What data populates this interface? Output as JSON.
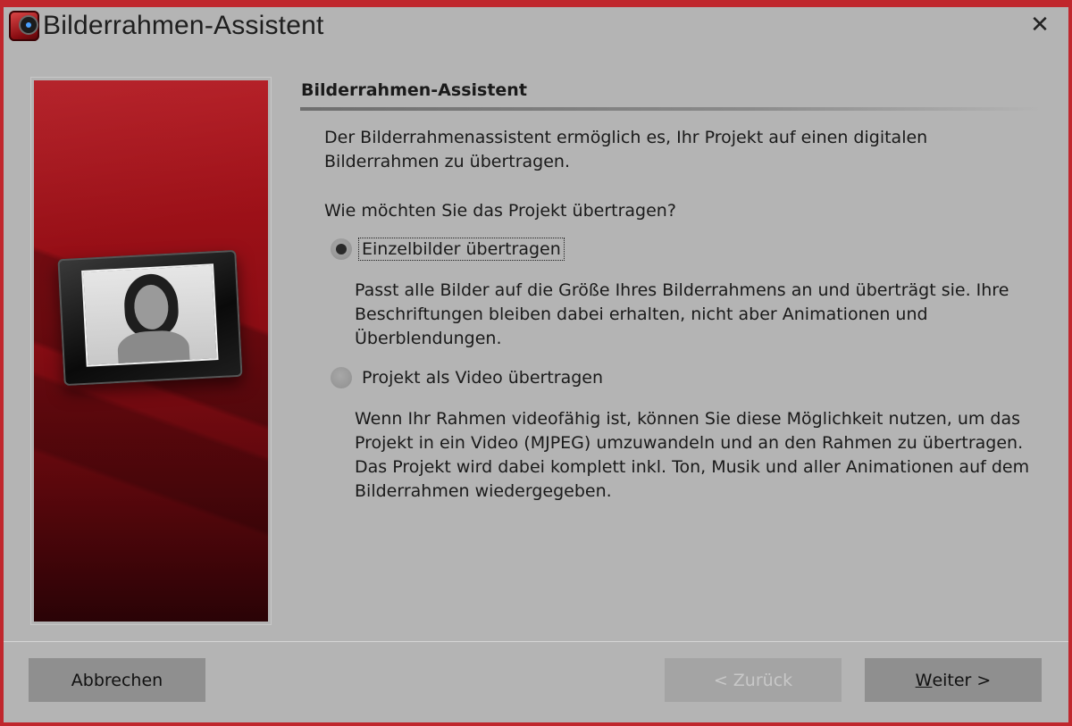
{
  "window": {
    "title": "Bilderrahmen-Assistent",
    "close_glyph": "✕",
    "accent_color": "#c0272d",
    "app_icon": "app-logo-icon"
  },
  "main": {
    "section_title": "Bilderrahmen-Assistent",
    "intro": "Der Bilderrahmenassistent ermöglich es, Ihr Projekt auf einen digitalen Bilderrahmen zu übertragen.",
    "question": "Wie möchten Sie das Projekt übertragen?",
    "options": [
      {
        "label": "Einzelbilder übertragen",
        "checked": true,
        "description": "Passt alle Bilder auf die Größe Ihres Bilderrahmens an und überträgt sie. Ihre Beschriftungen bleiben dabei erhalten, nicht aber Animationen und Überblendungen."
      },
      {
        "label": "Projekt als Video übertragen",
        "checked": false,
        "description": "Wenn Ihr Rahmen videofähig ist, können Sie diese Möglichkeit nutzen, um das Projekt in ein Video (MJPEG) umzuwandeln und an den Rahmen zu übertragen. Das Projekt wird dabei komplett inkl. Ton, Musik und aller Animationen auf dem Bilderrahmen wiedergegeben."
      }
    ]
  },
  "footer": {
    "cancel_label": "Abbrechen",
    "back_label": "< Zurück",
    "back_enabled": false,
    "next_label_accel": "W",
    "next_label_rest": "eiter >"
  }
}
